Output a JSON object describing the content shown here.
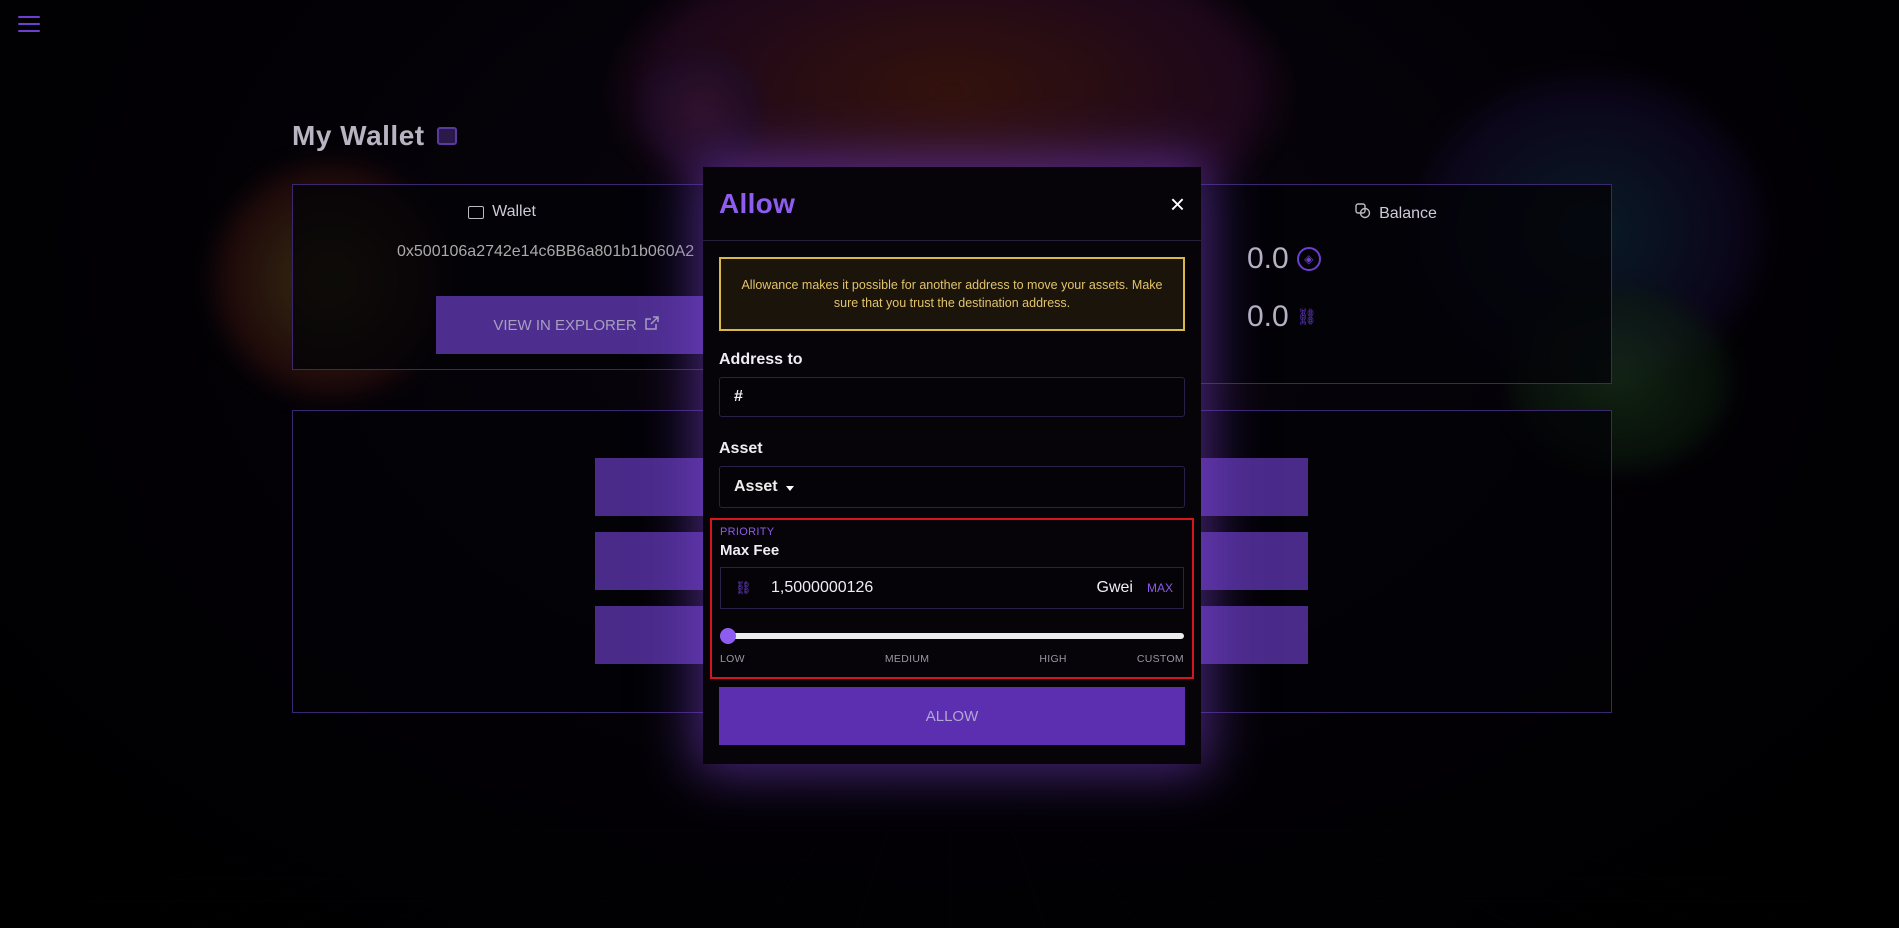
{
  "page": {
    "title": "My Wallet"
  },
  "wallet_card": {
    "heading": "Wallet",
    "address": "0x500106a2742e14c6BB6a801b1b060A2",
    "explorer_button": "VIEW IN EXPLORER"
  },
  "balance_card": {
    "heading": "Balance",
    "balances": [
      {
        "value": "0.0",
        "icon": "token-icon"
      },
      {
        "value": "0.0",
        "icon": "link-icon"
      }
    ]
  },
  "modal": {
    "title": "Allow",
    "close": "×",
    "warning": "Allowance makes it possible for another address to move your assets. Make sure that you trust the destination address.",
    "address_label": "Address to",
    "address_value": "#",
    "asset_label": "Asset",
    "asset_selected": "Asset",
    "priority_label": "PRIORITY",
    "max_fee_label": "Max Fee",
    "max_fee_value": "1,5000000126",
    "fee_unit": "Gwei",
    "max_button": "MAX",
    "slider_level": 0,
    "slider_ticks": [
      "LOW",
      "MEDIUM",
      "HIGH",
      "CUSTOM"
    ],
    "submit_button": "ALLOW"
  },
  "colors": {
    "accent": "#8e5cf0",
    "button": "#5b2fb0",
    "warning_border": "#d9b84a",
    "highlight_border": "#d6151e"
  }
}
